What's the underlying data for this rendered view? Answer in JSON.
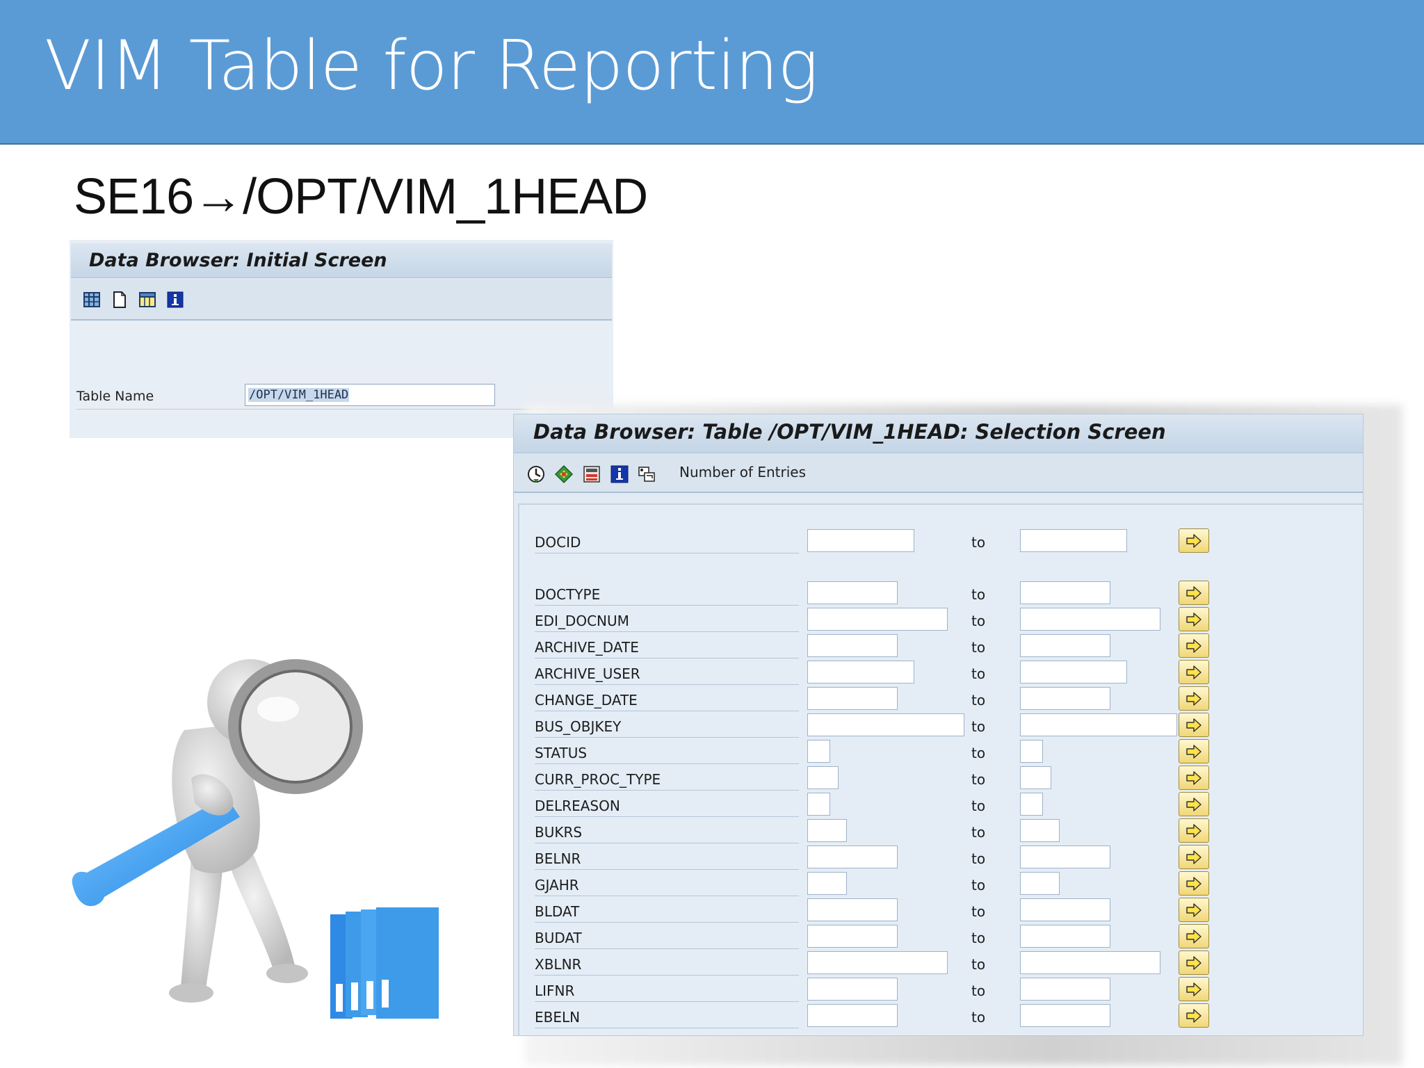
{
  "slide": {
    "title": "VIM Table for Reporting",
    "subtitle": "SE16→/OPT/VIM_1HEAD"
  },
  "initial_screen": {
    "title": "Data Browser: Initial Screen",
    "toolbar_icons": [
      "table-contents-icon",
      "create-entries-icon",
      "table-view-icon",
      "info-icon"
    ],
    "field_label": "Table Name",
    "field_value": "/OPT/VIM_1HEAD"
  },
  "selection_screen": {
    "title": "Data Browser: Table /OPT/VIM_1HEAD: Selection Screen",
    "toolbar_icons": [
      "execute-icon",
      "get-variant-icon",
      "save-variant-icon",
      "info-icon",
      "selection-options-icon"
    ],
    "number_of_entries_label": "Number of Entries",
    "to_label": "to",
    "fields": [
      {
        "name": "DOCID",
        "from": "",
        "to": ""
      },
      {
        "name": "DOCTYPE",
        "from": "",
        "to": ""
      },
      {
        "name": "EDI_DOCNUM",
        "from": "",
        "to": ""
      },
      {
        "name": "ARCHIVE_DATE",
        "from": "",
        "to": ""
      },
      {
        "name": "ARCHIVE_USER",
        "from": "",
        "to": ""
      },
      {
        "name": "CHANGE_DATE",
        "from": "",
        "to": ""
      },
      {
        "name": "BUS_OBJKEY",
        "from": "",
        "to": ""
      },
      {
        "name": "STATUS",
        "from": "",
        "to": ""
      },
      {
        "name": "CURR_PROC_TYPE",
        "from": "",
        "to": ""
      },
      {
        "name": "DELREASON",
        "from": "",
        "to": ""
      },
      {
        "name": "BUKRS",
        "from": "",
        "to": ""
      },
      {
        "name": "BELNR",
        "from": "",
        "to": ""
      },
      {
        "name": "GJAHR",
        "from": "",
        "to": ""
      },
      {
        "name": "BLDAT",
        "from": "",
        "to": ""
      },
      {
        "name": "BUDAT",
        "from": "",
        "to": ""
      },
      {
        "name": "XBLNR",
        "from": "",
        "to": ""
      },
      {
        "name": "LIFNR",
        "from": "",
        "to": ""
      },
      {
        "name": "EBELN",
        "from": "",
        "to": ""
      }
    ]
  },
  "illustration": {
    "icon": "magnifier-figure-icon",
    "colors": {
      "accent": "#3d9be9",
      "figure": "#d9d9d9"
    }
  },
  "colors": {
    "banner": "#5b9bd5",
    "window_bg": "#e2ebf4",
    "multi_select_button": "#f1d776"
  }
}
